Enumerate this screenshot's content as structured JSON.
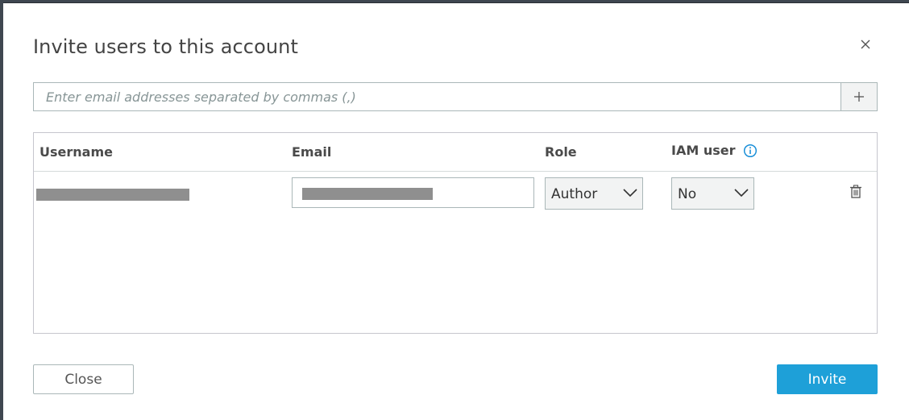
{
  "dialog": {
    "title": "Invite users to this account",
    "close_icon": "close-icon"
  },
  "email_entry": {
    "placeholder": "Enter email addresses separated by commas (,)",
    "add_icon": "plus-icon"
  },
  "table": {
    "columns": [
      "Username",
      "Email",
      "Role",
      "IAM user"
    ],
    "info_icon": "info-icon",
    "rows": [
      {
        "role": "Author",
        "iam_user": "No",
        "delete_icon": "trash-icon"
      }
    ]
  },
  "footer": {
    "close_label": "Close",
    "invite_label": "Invite"
  },
  "colors": {
    "primary_button": "#1ea0d8",
    "info_icon": "#1a8fd8"
  }
}
